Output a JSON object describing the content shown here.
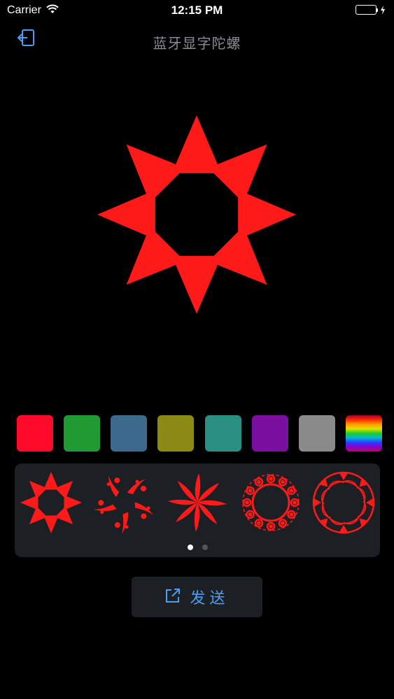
{
  "status_bar": {
    "carrier": "Carrier",
    "time": "12:15 PM"
  },
  "nav": {
    "title": "蓝牙显字陀螺",
    "back_icon": "logout-icon"
  },
  "preview": {
    "pattern": "octagon-star",
    "color": "#ff1a1a"
  },
  "swatches": [
    {
      "name": "red",
      "color": "#ff0a2a"
    },
    {
      "name": "green",
      "color": "#229a33"
    },
    {
      "name": "steel-blue",
      "color": "#3b6a8c"
    },
    {
      "name": "olive",
      "color": "#8c8914"
    },
    {
      "name": "teal",
      "color": "#2a8f82"
    },
    {
      "name": "purple",
      "color": "#7a0fa0"
    },
    {
      "name": "gray",
      "color": "#8a8a8a"
    },
    {
      "name": "rainbow",
      "color": "rainbow"
    }
  ],
  "patterns": [
    {
      "name": "octagon-star"
    },
    {
      "name": "splash-spiral"
    },
    {
      "name": "pinwheel"
    },
    {
      "name": "scroll-ring"
    },
    {
      "name": "ornate-ring"
    }
  ],
  "pager": {
    "pages": 2,
    "current": 1
  },
  "send_button": {
    "label": "发送",
    "icon": "share-icon",
    "color": "#4a9ff5"
  }
}
